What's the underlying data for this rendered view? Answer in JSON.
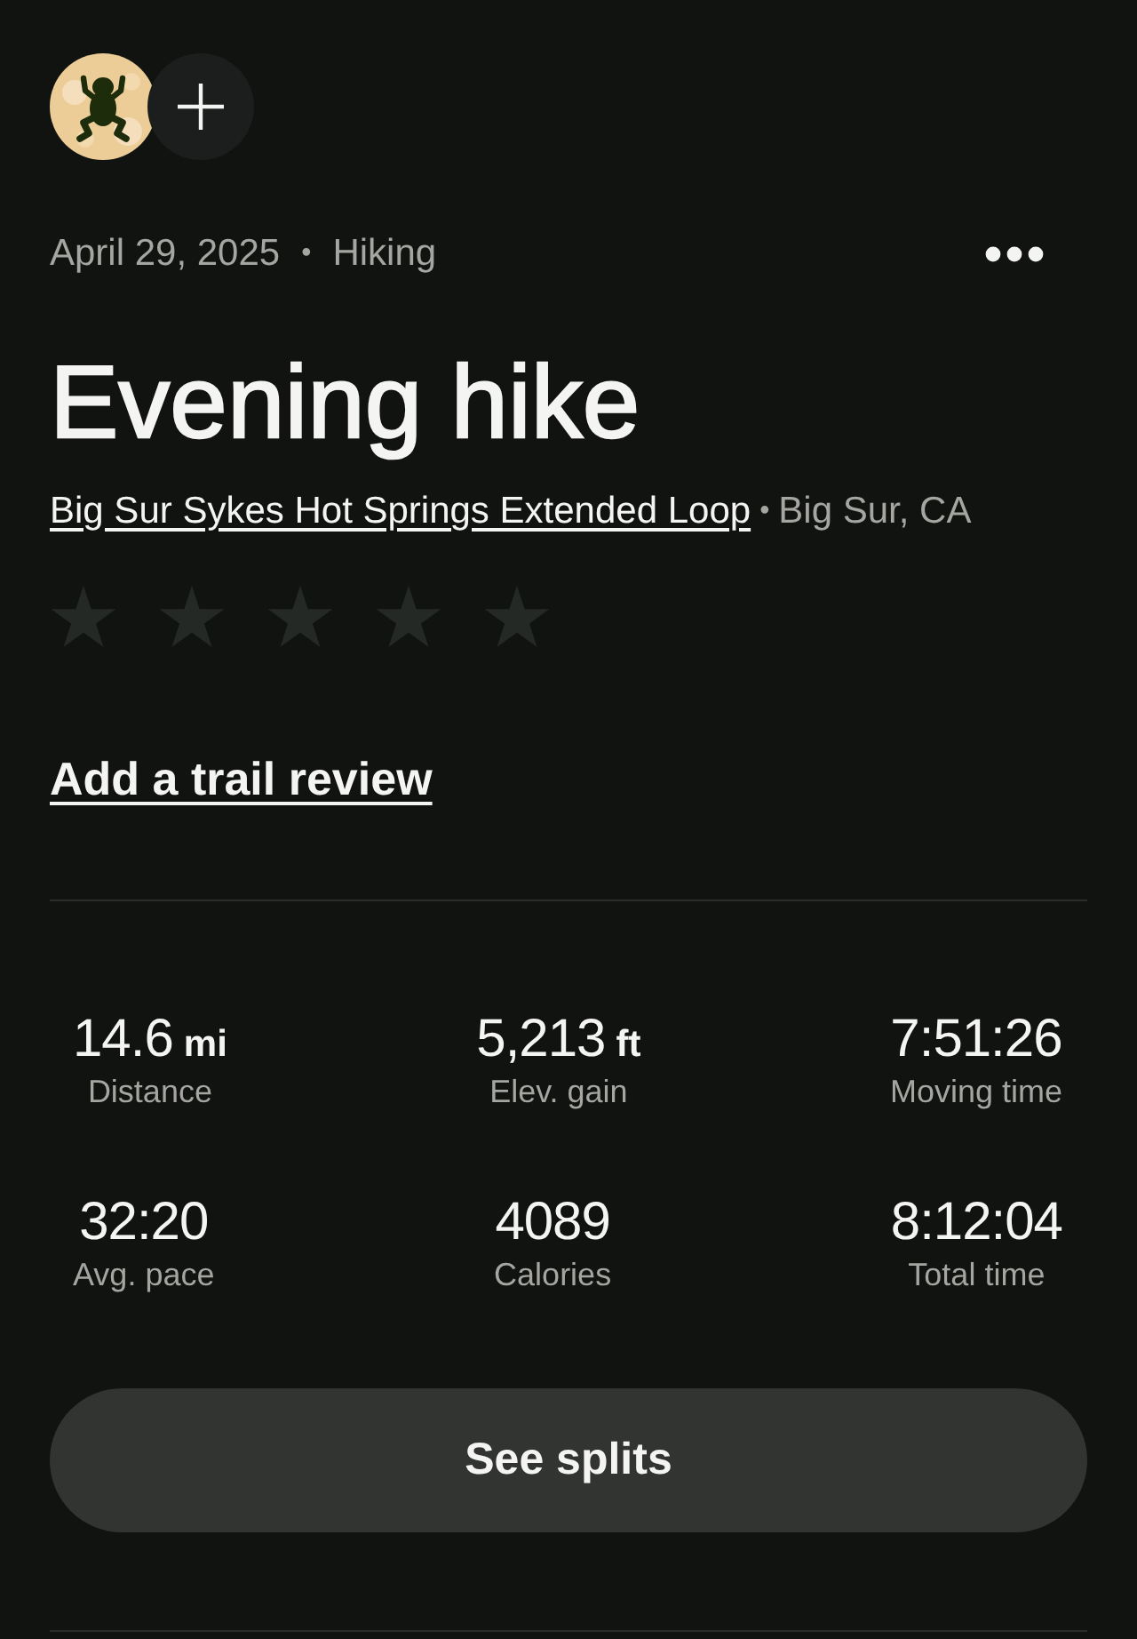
{
  "header": {
    "date": "April 29, 2025",
    "separator": "•",
    "activity_type": "Hiking"
  },
  "title": "Evening hike",
  "trail": {
    "name": "Big Sur Sykes Hot Springs Extended Loop",
    "separator": "•",
    "location": "Big Sur, CA"
  },
  "rating": {
    "stars": 0
  },
  "review_link": "Add a trail review",
  "stat_rows": [
    [
      {
        "value": "14.6",
        "unit": "mi",
        "label": "Distance"
      },
      {
        "value": "5,213",
        "unit": "ft",
        "label": "Elev. gain"
      },
      {
        "value": "7:51:26",
        "label": "Moving time"
      }
    ],
    [
      {
        "value": "32:20",
        "label": "Avg. pace"
      },
      {
        "value": "4089",
        "label": "Calories"
      },
      {
        "value": "8:12:04",
        "label": "Total time"
      }
    ]
  ],
  "splits_button": "See splits"
}
